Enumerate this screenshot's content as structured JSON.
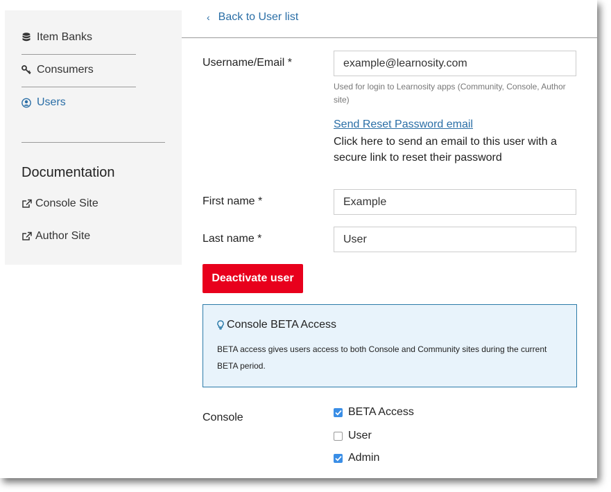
{
  "sidebar": {
    "items": [
      {
        "label": "Item Banks",
        "icon": "database-icon"
      },
      {
        "label": "Consumers",
        "icon": "key-icon"
      },
      {
        "label": "Users",
        "icon": "user-circle-icon",
        "active": true
      }
    ],
    "documentation": {
      "heading": "Documentation",
      "links": [
        {
          "label": "Console Site",
          "icon": "external-link-icon"
        },
        {
          "label": "Author Site",
          "icon": "external-link-icon"
        }
      ]
    }
  },
  "main": {
    "back_label": "Back to User list",
    "username": {
      "label": "Username/Email *",
      "value": "example@learnosity.com",
      "help": "Used for login to Learnosity apps (Community, Console, Author site)"
    },
    "reset": {
      "link": "Send Reset Password email",
      "description": "Click here to send an email to this user with a secure link to reset their password"
    },
    "first_name": {
      "label": "First name *",
      "value": "Example"
    },
    "last_name": {
      "label": "Last name *",
      "value": "User"
    },
    "deactivate_label": "Deactivate user",
    "beta": {
      "title": "Console BETA Access",
      "body": "BETA access gives users access to both Console and Community sites during the current BETA period."
    },
    "console": {
      "label": "Console",
      "options": [
        {
          "label": "BETA Access",
          "checked": true
        },
        {
          "label": "User",
          "checked": false
        },
        {
          "label": "Admin",
          "checked": true
        }
      ]
    }
  },
  "colors": {
    "accent": "#2a6ea6",
    "danger": "#e8001c",
    "info_bg": "#e8f3fb",
    "info_border": "#2a7aa8",
    "checkbox": "#3a8ee6"
  }
}
